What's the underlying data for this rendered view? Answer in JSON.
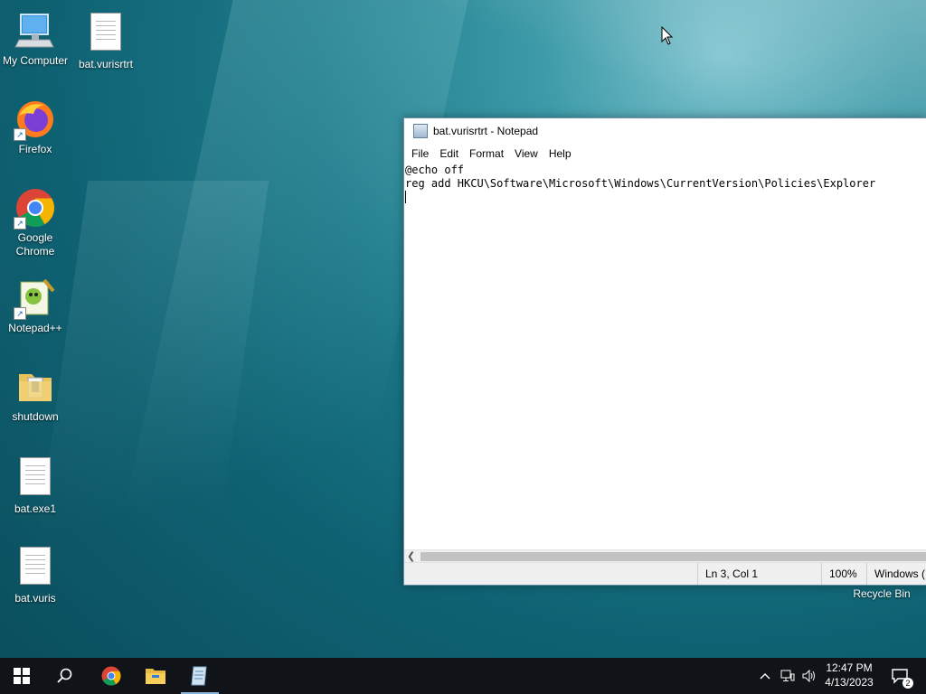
{
  "desktop": {
    "icons": [
      {
        "label": "My Computer",
        "icon": "computer-icon"
      },
      {
        "label": "bat.vurisrtrt",
        "icon": "text-file-icon"
      },
      {
        "label": "Firefox",
        "icon": "firefox-icon"
      },
      {
        "label": "Google Chrome",
        "icon": "chrome-icon"
      },
      {
        "label": "Notepad++",
        "icon": "notepad-plus-plus-icon"
      },
      {
        "label": "shutdown",
        "icon": "folder-icon"
      },
      {
        "label": "bat.exe1",
        "icon": "text-file-icon"
      },
      {
        "label": "bat.vuris",
        "icon": "text-file-icon"
      },
      {
        "label": "Recycle Bin",
        "icon": "recycle-bin-icon"
      }
    ]
  },
  "notepad": {
    "title": "bat.vurisrtrt - Notepad",
    "menu": [
      "File",
      "Edit",
      "Format",
      "View",
      "Help"
    ],
    "content_lines": [
      "@echo off",
      "reg add HKCU\\Software\\Microsoft\\Windows\\CurrentVersion\\Policies\\Explorer"
    ],
    "status": {
      "position": "Ln 3, Col 1",
      "zoom": "100%",
      "line_ending": "Windows ("
    }
  },
  "taskbar": {
    "time": "12:47 PM",
    "date": "4/13/2023",
    "notification_count": "2",
    "apps": [
      "start-icon",
      "search-icon",
      "chrome-icon",
      "file-explorer-icon",
      "notepad-icon"
    ]
  },
  "colors": {
    "taskbar_bg": "#101418",
    "active_indicator": "#8ab4d8",
    "wallpaper_accent": "#1c7a8a"
  }
}
